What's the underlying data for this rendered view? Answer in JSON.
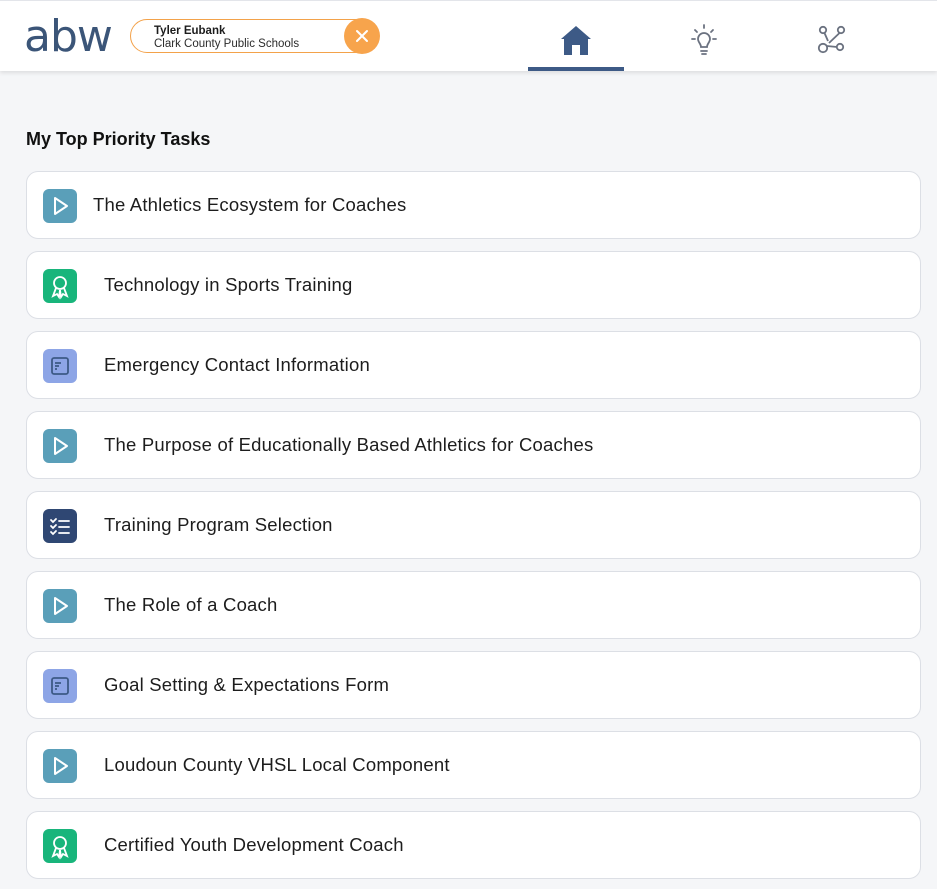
{
  "header": {
    "logo_text": "abw",
    "user": {
      "name": "Tyler Eubank",
      "organization": "Clark County Public Schools"
    },
    "nav": [
      {
        "icon": "home-icon",
        "active": true
      },
      {
        "icon": "lightbulb-icon",
        "active": false
      },
      {
        "icon": "network-icon",
        "active": false
      }
    ],
    "colors": {
      "accent": "#3d5a86",
      "pill_border": "#f3a24a",
      "close": "#f7a44c"
    }
  },
  "main": {
    "section_title": "My Top Priority Tasks",
    "tasks": [
      {
        "label": "The Athletics Ecosystem for Coaches",
        "icon": "video-play-icon"
      },
      {
        "label": "Technology in Sports Training",
        "icon": "award-ribbon-icon"
      },
      {
        "label": "Emergency Contact Information",
        "icon": "form-document-icon"
      },
      {
        "label": "The Purpose of Educationally Based Athletics for Coaches",
        "icon": "video-play-icon"
      },
      {
        "label": "Training Program Selection",
        "icon": "checklist-icon"
      },
      {
        "label": "The Role of a Coach",
        "icon": "video-play-icon"
      },
      {
        "label": "Goal Setting & Expectations Form",
        "icon": "form-document-icon"
      },
      {
        "label": "Loudoun County VHSL Local Component",
        "icon": "video-play-icon"
      },
      {
        "label": "Certified Youth Development Coach",
        "icon": "award-ribbon-icon"
      }
    ]
  }
}
